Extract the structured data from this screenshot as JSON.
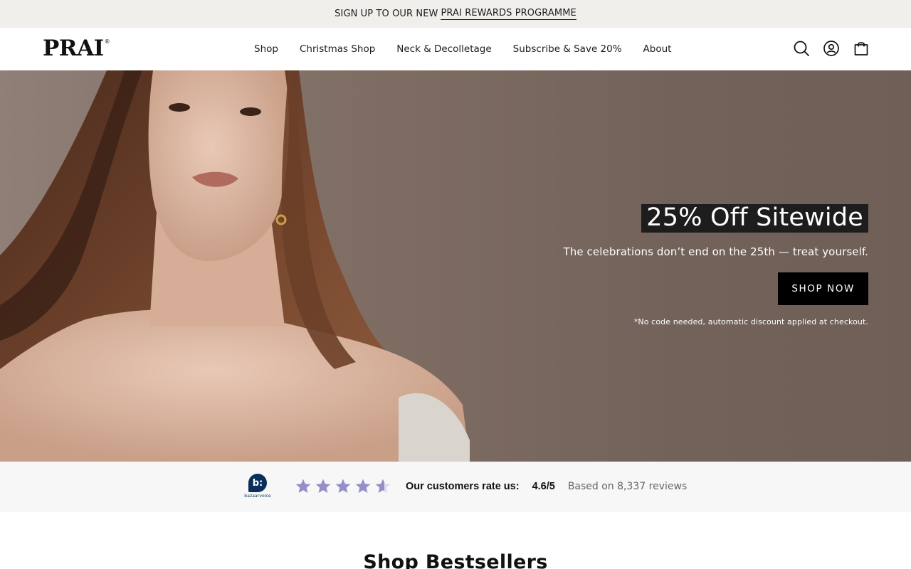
{
  "announcement": {
    "prefix": "SIGN UP TO OUR NEW",
    "link": "PRAI REWARDS PROGRAMME"
  },
  "header": {
    "logo": "PRAI",
    "logo_mark": "®",
    "nav": [
      {
        "label": "Shop"
      },
      {
        "label": "Christmas Shop"
      },
      {
        "label": "Neck & Decolletage"
      },
      {
        "label": "Subscribe & Save 20%"
      },
      {
        "label": "About"
      }
    ],
    "icons": [
      "search-icon",
      "account-icon",
      "bag-icon"
    ]
  },
  "hero": {
    "title": "25% Off Sitewide",
    "subtitle": "The celebrations don’t end on the 25th — treat yourself.",
    "cta": "SHOP NOW",
    "note": "*No code needed, automatic discount applied at checkout."
  },
  "rating": {
    "brand_mark": "b:",
    "brand_text": "bazaarvoice",
    "label": "Our customers rate us:",
    "score": "4.6/5",
    "count": "Based on 8,337 reviews",
    "stars_value": 4.6,
    "stars_max": 5,
    "star_color": "#9490c7"
  },
  "section": {
    "title": "Shop Bestsellers"
  },
  "colors": {
    "announcement_bg": "#f1efeb",
    "cta_bg": "#000000",
    "title_highlight": "#1d1d1d"
  }
}
